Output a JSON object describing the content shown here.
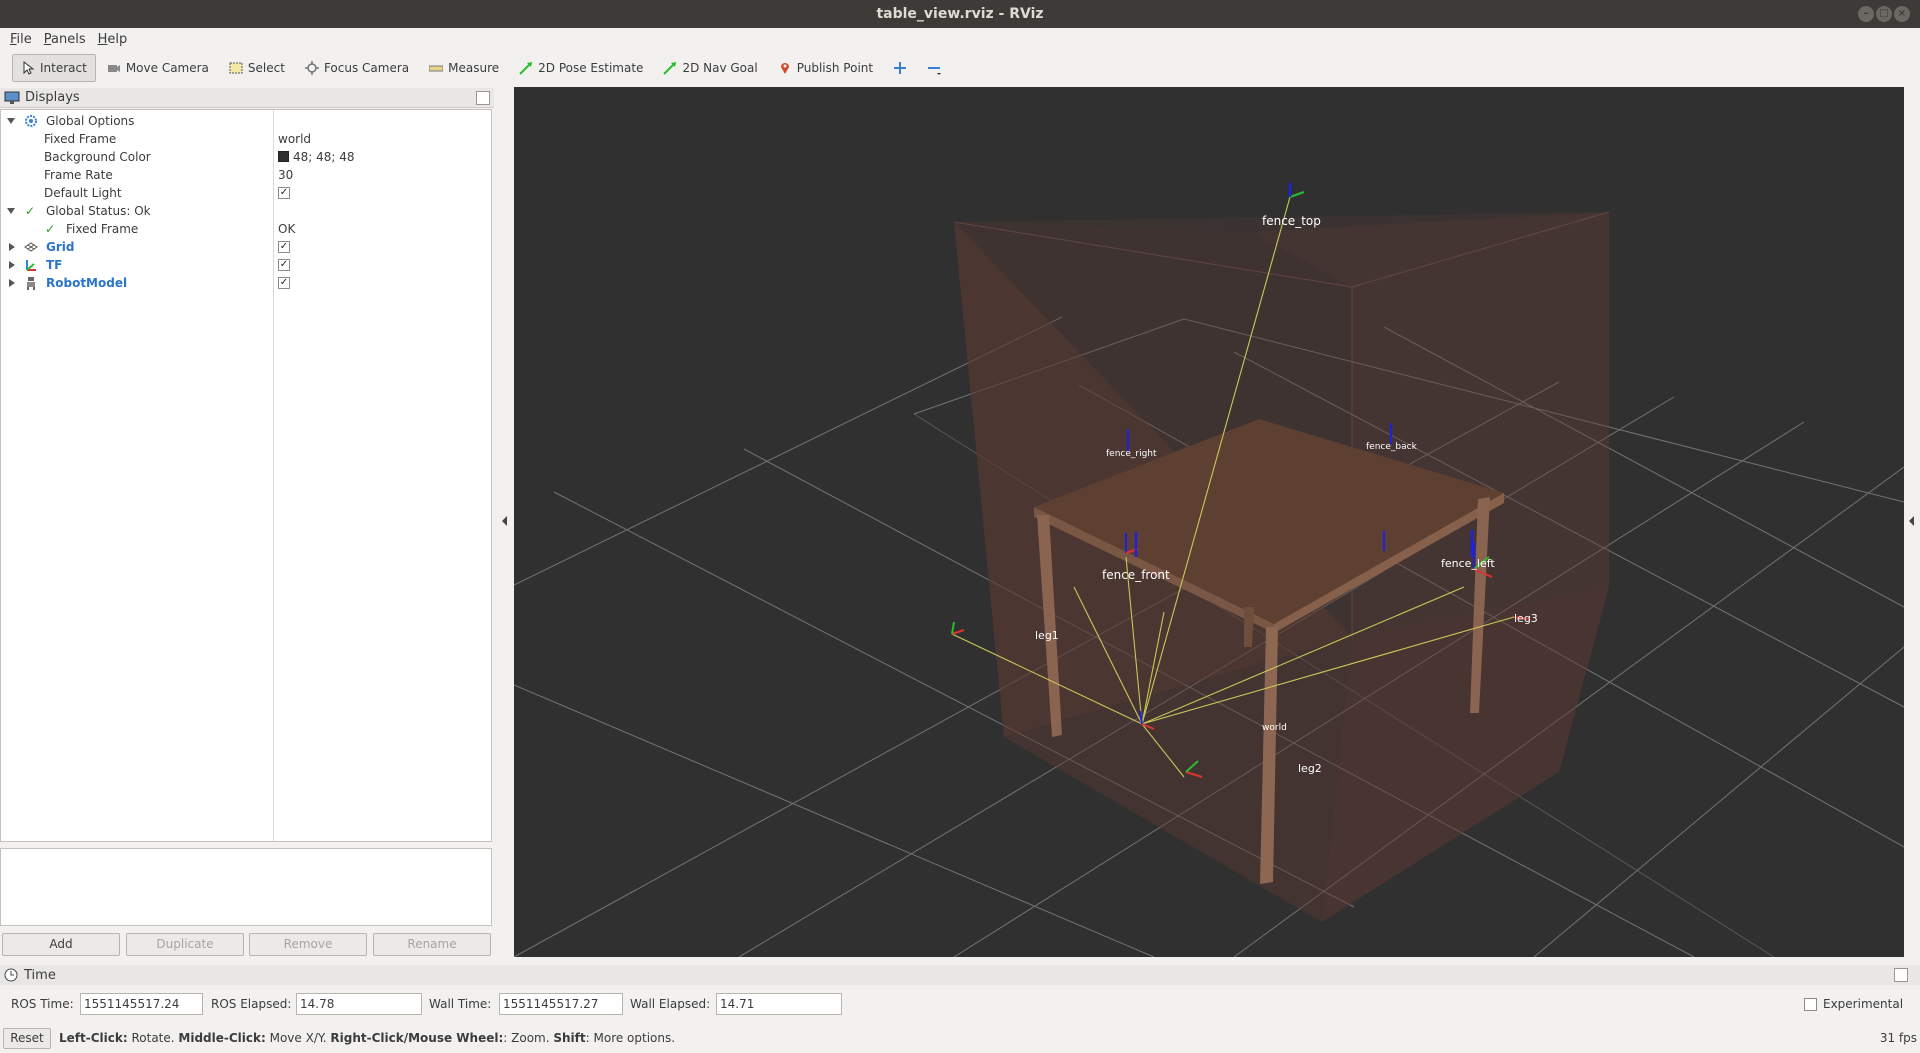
{
  "window": {
    "title": "table_view.rviz - RViz"
  },
  "menu": [
    {
      "label": "File",
      "key": "F",
      "rest": "ile"
    },
    {
      "label": "Panels",
      "key": "P",
      "rest": "anels"
    },
    {
      "label": "Help",
      "key": "H",
      "rest": "elp"
    }
  ],
  "toolbar": {
    "interact": "Interact",
    "move_camera": "Move Camera",
    "select": "Select",
    "focus_camera": "Focus Camera",
    "measure": "Measure",
    "pose_estimate": "2D Pose Estimate",
    "nav_goal": "2D Nav Goal",
    "publish_point": "Publish Point"
  },
  "displays": {
    "title": "Displays",
    "global_options": "Global Options",
    "fixed_frame_label": "Fixed Frame",
    "fixed_frame_value": "world",
    "background_color_label": "Background Color",
    "background_color_value": "48; 48; 48",
    "frame_rate_label": "Frame Rate",
    "frame_rate_value": "30",
    "default_light_label": "Default Light",
    "global_status": "Global Status: Ok",
    "status_fixed_frame_label": "Fixed Frame",
    "status_fixed_frame_value": "OK",
    "grid": "Grid",
    "tf": "TF",
    "robot_model": "RobotModel"
  },
  "buttons": {
    "add": "Add",
    "duplicate": "Duplicate",
    "remove": "Remove",
    "rename": "Rename"
  },
  "viewport": {
    "frames": {
      "fence_top": "fence_top",
      "fence_right": "fence_right",
      "fence_back": "fence_back",
      "fence_front": "fence_front",
      "fence_left": "fence_left",
      "leg1": "leg1",
      "leg2": "leg2",
      "leg3": "leg3",
      "world": "world"
    }
  },
  "time": {
    "title": "Time",
    "ros_time_label": "ROS Time:",
    "ros_time": "1551145517.24",
    "ros_elapsed_label": "ROS Elapsed:",
    "ros_elapsed": "14.78",
    "wall_time_label": "Wall Time:",
    "wall_time": "1551145517.27",
    "wall_elapsed_label": "Wall Elapsed:",
    "wall_elapsed": "14.71",
    "experimental": "Experimental"
  },
  "status": {
    "reset": "Reset",
    "left_click": "Left-Click:",
    "left_click_desc": " Rotate. ",
    "middle_click": "Middle-Click:",
    "middle_click_desc": " Move X/Y. ",
    "right_click": "Right-Click/Mouse Wheel:",
    "right_click_desc": ": Zoom. ",
    "shift": "Shift",
    "shift_desc": ": More options.",
    "fps": "31 fps"
  },
  "colors": {
    "background": "#303030",
    "table": "#6b4a38",
    "fence": "#5a3a32",
    "accent": "#2a74c9"
  }
}
